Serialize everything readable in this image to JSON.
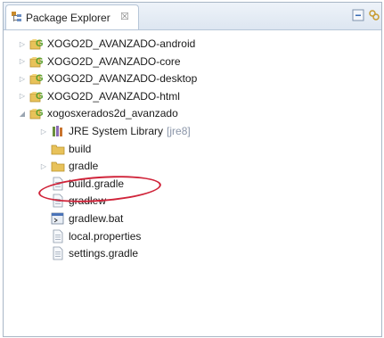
{
  "view": {
    "title": "Package Explorer",
    "close_mark": "☒"
  },
  "tree": {
    "projects": [
      {
        "label": "XOGO2D_AVANZADO-android",
        "expanded": false
      },
      {
        "label": "XOGO2D_AVANZADO-core",
        "expanded": false
      },
      {
        "label": "XOGO2D_AVANZADO-desktop",
        "expanded": false
      },
      {
        "label": "XOGO2D_AVANZADO-html",
        "expanded": false
      },
      {
        "label": "xogosxerados2d_avanzado",
        "expanded": true
      }
    ],
    "children": [
      {
        "label": "JRE System Library",
        "suffix": "[jre8]",
        "icon": "library-icon",
        "expandable": true
      },
      {
        "label": "build",
        "icon": "folder-icon",
        "expandable": false
      },
      {
        "label": "gradle",
        "icon": "folder-icon",
        "expandable": true
      },
      {
        "label": "build.gradle",
        "icon": "file-icon",
        "expandable": false
      },
      {
        "label": "gradlew",
        "icon": "file-icon",
        "expandable": false
      },
      {
        "label": "gradlew.bat",
        "icon": "bat-file-icon",
        "expandable": false
      },
      {
        "label": "local.properties",
        "icon": "file-icon",
        "expandable": false
      },
      {
        "label": "settings.gradle",
        "icon": "file-icon",
        "expandable": false
      }
    ]
  },
  "colors": {
    "highlight_circle": "#d0243a",
    "folder": "#e8c25a",
    "project_green": "#5aa02c"
  }
}
